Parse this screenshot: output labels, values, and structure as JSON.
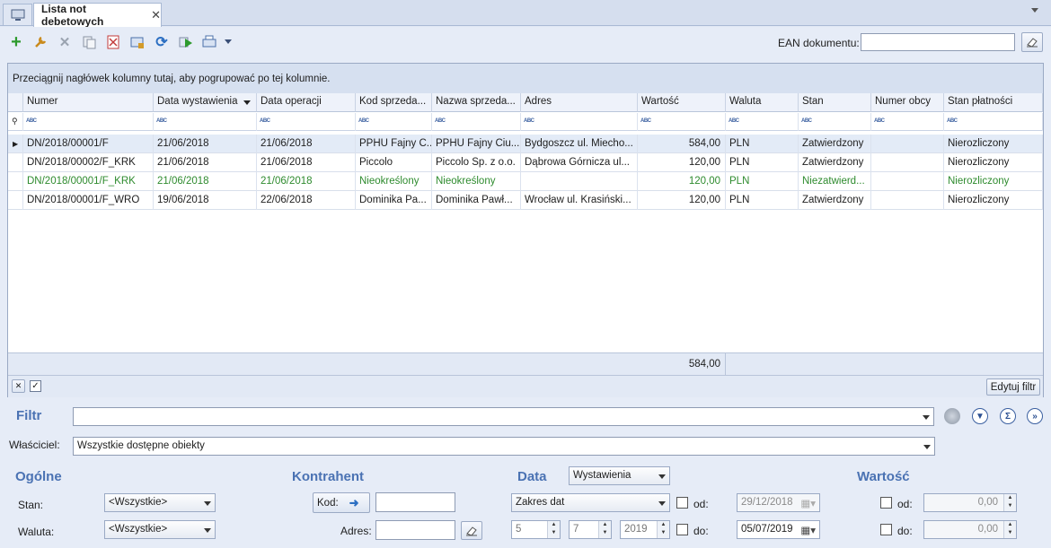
{
  "tab": {
    "title": "Lista not debetowych",
    "close": "✕"
  },
  "toolbar": {
    "ean_label": "EAN dokumentu:",
    "ean_value": ""
  },
  "grid": {
    "group_hint": "Przeciągnij nagłówek kolumny tutaj, aby pogrupować po tej kolumnie.",
    "columns": [
      "Numer",
      "Data wystawienia",
      "Data operacji",
      "Kod sprzeda...",
      "Nazwa sprzeda...",
      "Adres",
      "Wartość",
      "Waluta",
      "Stan",
      "Numer obcy",
      "Stan płatności"
    ],
    "rows": [
      {
        "numer": "DN/2018/00001/F",
        "data_wyst": "21/06/2018",
        "data_op": "21/06/2018",
        "kod": "PPHU Fajny C...",
        "nazwa": "PPHU Fajny Ciu...",
        "adres": "Bydgoszcz ul. Miecho...",
        "wartosc": "584,00",
        "waluta": "PLN",
        "stan": "Zatwierdzony",
        "numer_obcy": "",
        "platnosc": "Nierozliczony"
      },
      {
        "numer": "DN/2018/00002/F_KRK",
        "data_wyst": "21/06/2018",
        "data_op": "21/06/2018",
        "kod": "Piccolo",
        "nazwa": "Piccolo Sp. z o.o.",
        "adres": "Dąbrowa Górnicza  ul...",
        "wartosc": "120,00",
        "waluta": "PLN",
        "stan": "Zatwierdzony",
        "numer_obcy": "",
        "platnosc": "Nierozliczony"
      },
      {
        "numer": "DN/2018/00001/F_KRK",
        "data_wyst": "21/06/2018",
        "data_op": "21/06/2018",
        "kod": "Nieokreślony",
        "nazwa": "Nieokreślony",
        "adres": "",
        "wartosc": "120,00",
        "waluta": "PLN",
        "stan": "Niezatwierd...",
        "numer_obcy": "",
        "platnosc": "Nierozliczony"
      },
      {
        "numer": "DN/2018/00001/F_WRO",
        "data_wyst": "19/06/2018",
        "data_op": "22/06/2018",
        "kod": "Dominika Pa...",
        "nazwa": "Dominika Pawł...",
        "adres": "Wrocław ul. Krasiński...",
        "wartosc": "120,00",
        "waluta": "PLN",
        "stan": "Zatwierdzony",
        "numer_obcy": "",
        "platnosc": "Nierozliczony"
      }
    ],
    "sum": "584,00",
    "edit_filter": "Edytuj filtr"
  },
  "filter": {
    "label": "Filtr",
    "value": "",
    "owner_label": "Właściciel:",
    "owner_value": "Wszystkie dostępne obiekty"
  },
  "general": {
    "title": "Ogólne",
    "stan_label": "Stan:",
    "stan_value": "<Wszystkie>",
    "waluta_label": "Waluta:",
    "waluta_value": "<Wszystkie>"
  },
  "contractor": {
    "title": "Kontrahent",
    "kod_label": "Kod:",
    "kod_value": "",
    "adres_label": "Adres:",
    "adres_value": ""
  },
  "date": {
    "title": "Data",
    "type_value": "Wystawienia",
    "range_value": "Zakres dat",
    "spin1": "5",
    "spin2": "7",
    "spin3": "2019",
    "od_label": "od:",
    "od_value": "29/12/2018",
    "do_label": "do:",
    "do_value": "05/07/2019"
  },
  "value": {
    "title": "Wartość",
    "od_label": "od:",
    "od_value": "0,00",
    "do_label": "do:",
    "do_value": "0,00"
  },
  "colors": {
    "accent": "#4a72b3",
    "green_row": "#2e8b2e",
    "selected": "#e3ebf7"
  }
}
